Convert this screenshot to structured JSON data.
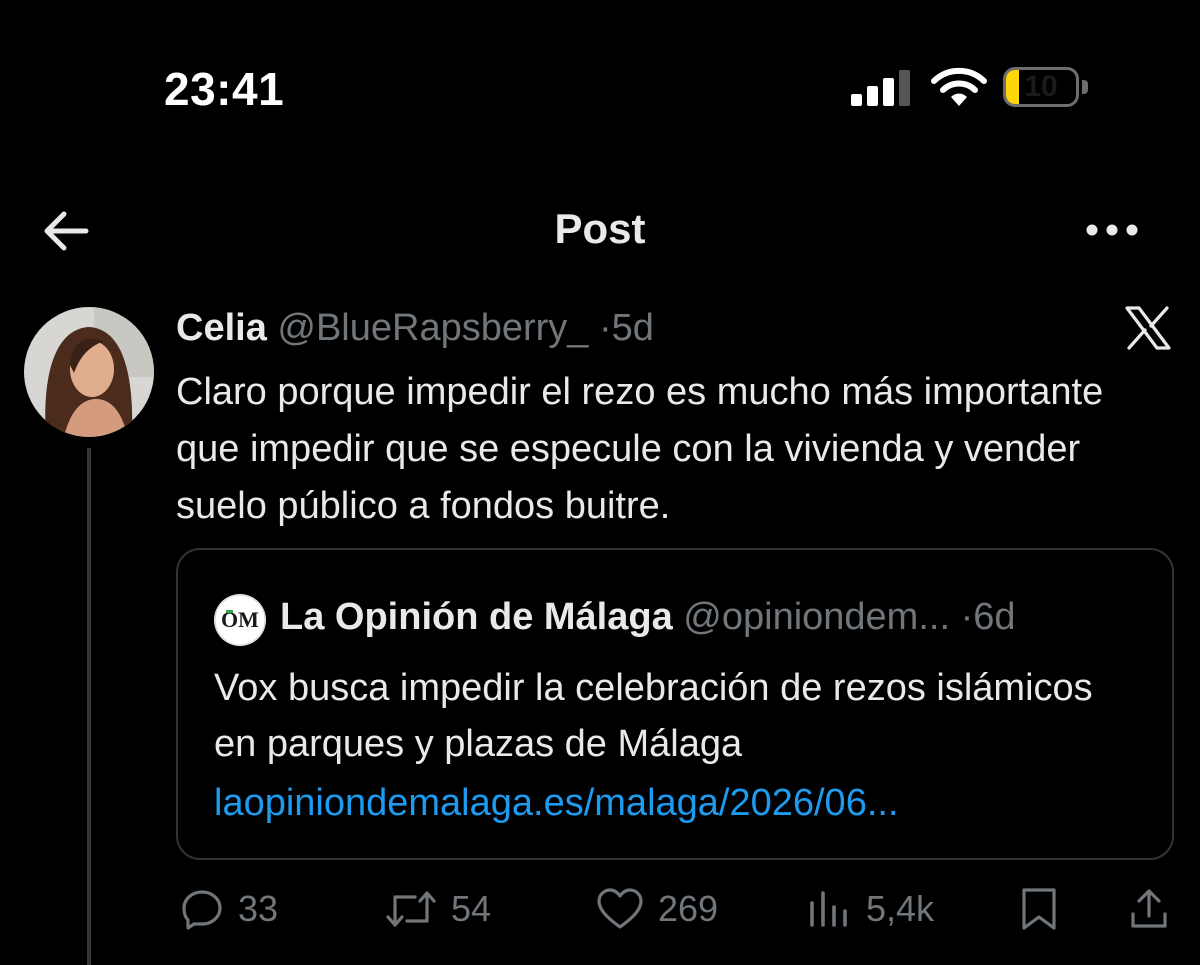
{
  "status_bar": {
    "time": "23:41",
    "battery_level": "10",
    "battery_fraction": 0.18,
    "signal_bars": 3
  },
  "header": {
    "title": "Post",
    "back_icon": "arrow-left-icon",
    "more_icon": "more-horizontal-icon"
  },
  "post": {
    "author_name": "Celia",
    "author_handle": "@BlueRapsberry_",
    "separator": "·",
    "age": "5d",
    "text": "Claro porque impedir el rezo es mucho más importante que impedir que se especule con la vivienda y vender suelo público a fondos buitre."
  },
  "quote": {
    "logo_text": "OM",
    "author_name": "La Opinión de Málaga",
    "author_handle": "@opiniondem...",
    "separator": "·",
    "age": "6d",
    "text": "Vox busca impedir la celebración de rezos islámicos en parques y plazas de Málaga",
    "link": "laopiniondemalaga.es/malaga/2026/06..."
  },
  "actions": {
    "replies": "33",
    "reposts": "54",
    "likes": "269",
    "views": "5,4k"
  },
  "colors": {
    "background": "#000000",
    "text": "#e7e9ea",
    "muted": "#71767b",
    "link": "#1d9bf0",
    "battery": "#ffd60a"
  }
}
